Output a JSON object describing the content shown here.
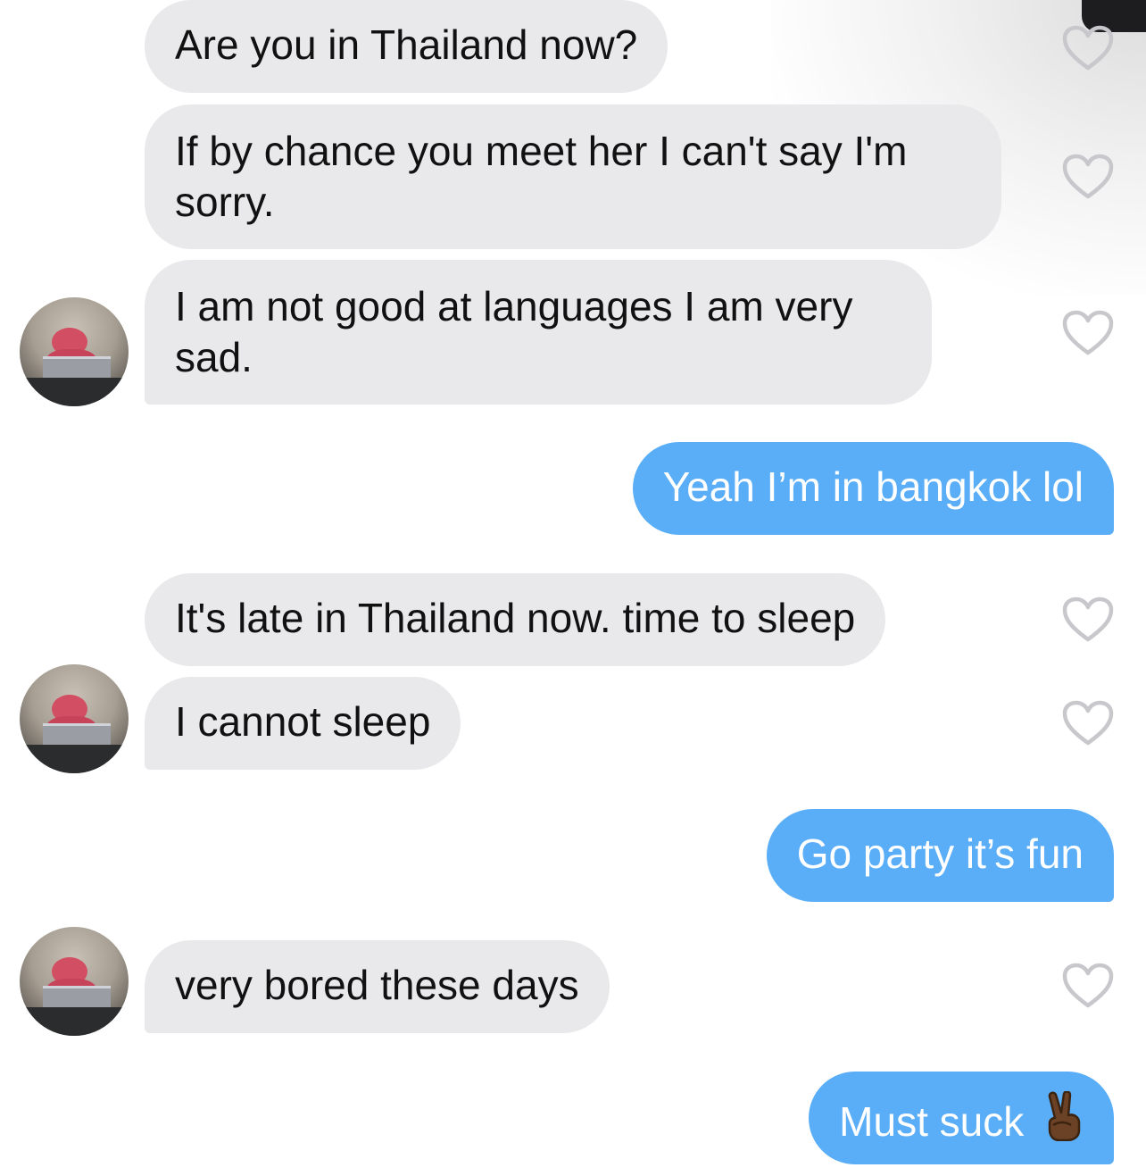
{
  "messages": [
    {
      "side": "incoming",
      "text": "Are you in Thailand now?"
    },
    {
      "side": "incoming",
      "text": "If by chance you meet her  I can't say I'm sorry."
    },
    {
      "side": "incoming",
      "text": "I am not good at languages  I am very sad."
    },
    {
      "side": "outgoing",
      "text": "Yeah I’m in bangkok lol"
    },
    {
      "side": "incoming",
      "text": "It's late in Thailand now.  time to sleep"
    },
    {
      "side": "incoming",
      "text": "I cannot sleep"
    },
    {
      "side": "outgoing",
      "text": "Go party it’s fun"
    },
    {
      "side": "incoming",
      "text": "very bored these days"
    },
    {
      "side": "outgoing",
      "text": "Must suck",
      "emoji": "victory-hand-dark-skin-tone"
    }
  ],
  "colors": {
    "incoming_bubble": "#e9e9eb",
    "outgoing_bubble": "#5aadf7",
    "heart_outline": "#c8c8cc"
  },
  "icons": {
    "like": "heart-outline-icon",
    "avatar": "plush-bear-with-laptop"
  }
}
